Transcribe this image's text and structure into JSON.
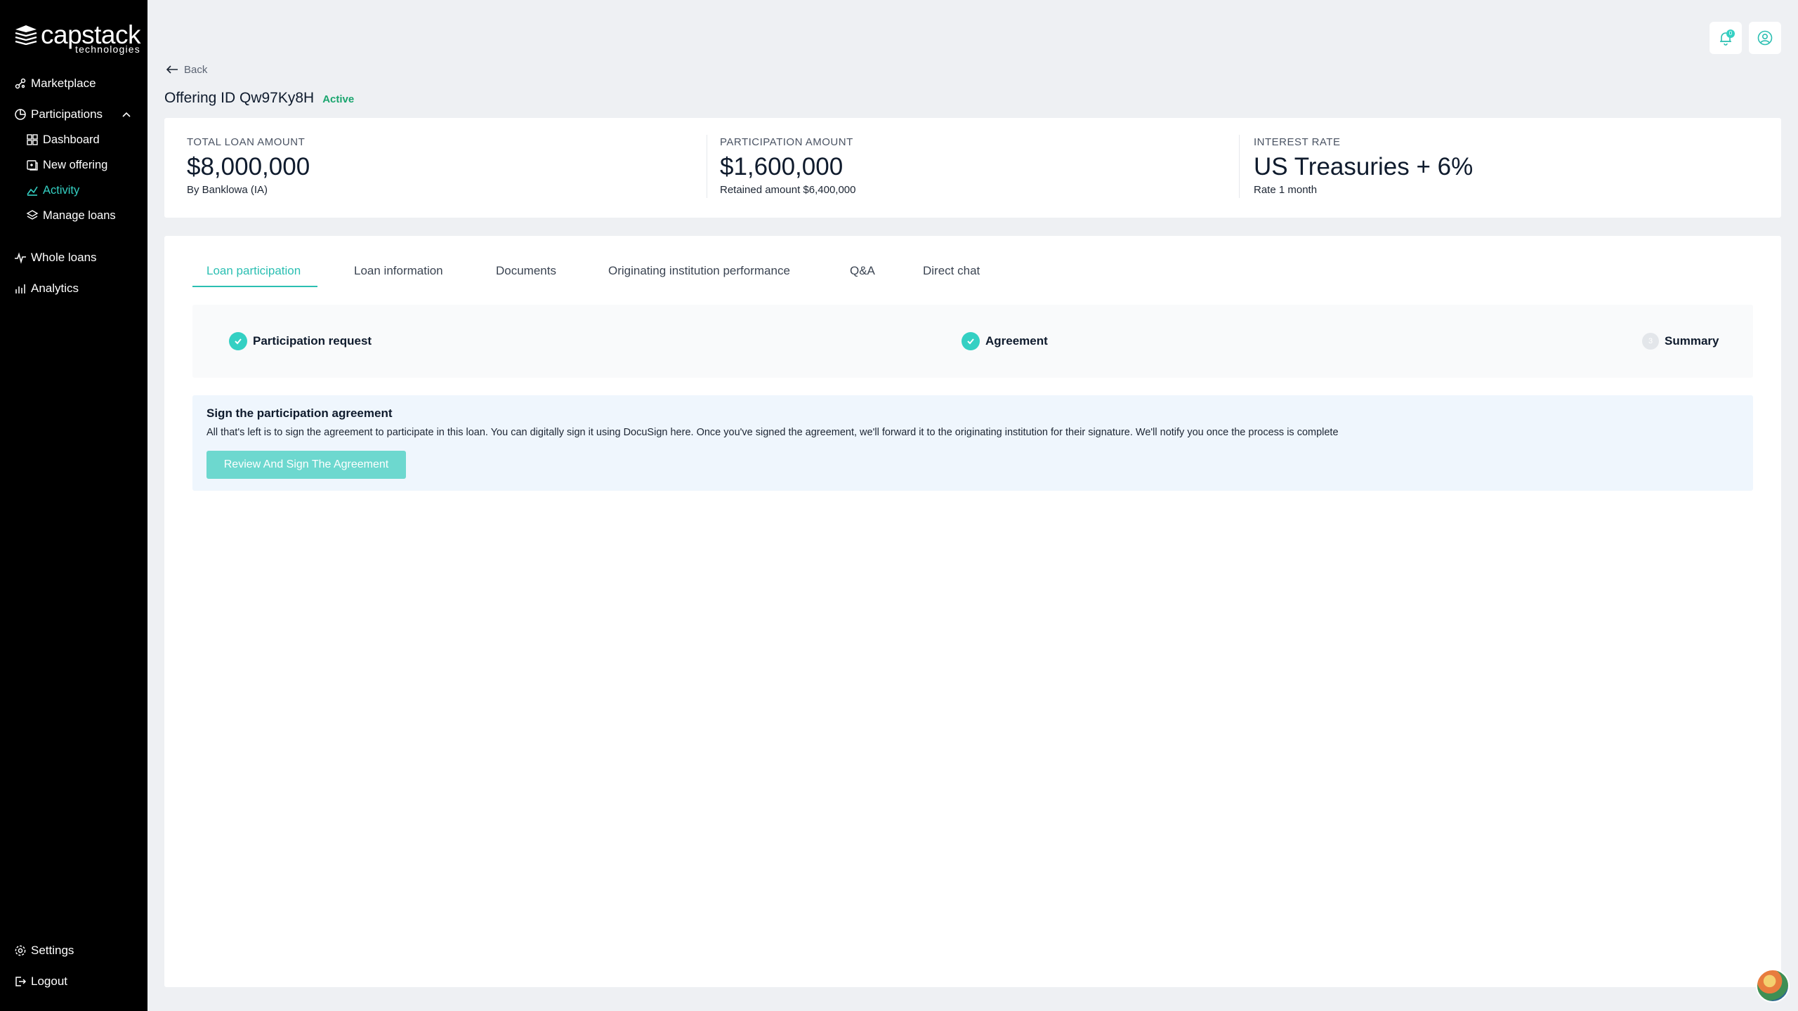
{
  "brand": {
    "name": "capstack",
    "sub": "technologies"
  },
  "sidebar": {
    "items": [
      {
        "label": "Marketplace",
        "icon": "marketplace-icon"
      },
      {
        "label": "Participations",
        "icon": "participations-icon"
      },
      {
        "label": "Dashboard",
        "icon": "dashboard-icon"
      },
      {
        "label": "New offering",
        "icon": "new-offering-icon"
      },
      {
        "label": "Activity",
        "icon": "activity-icon"
      },
      {
        "label": "Manage loans",
        "icon": "manage-loans-icon"
      },
      {
        "label": "Whole loans",
        "icon": "whole-loans-icon"
      },
      {
        "label": "Analytics",
        "icon": "analytics-icon"
      }
    ],
    "bottom": [
      {
        "label": "Settings",
        "icon": "gear-icon"
      },
      {
        "label": "Logout",
        "icon": "logout-icon"
      }
    ]
  },
  "topbar": {
    "notification_count": "0"
  },
  "header": {
    "back_label": "Back",
    "title": "Offering ID Qw97Ky8H",
    "status": "Active"
  },
  "stats": [
    {
      "label": "TOTAL LOAN AMOUNT",
      "value": "$8,000,000",
      "sub": "By Banklowa (IA)"
    },
    {
      "label": "PARTICIPATION AMOUNT",
      "value": "$1,600,000",
      "sub": "Retained amount $6,400,000"
    },
    {
      "label": "INTEREST RATE",
      "value": "US Treasuries + 6%",
      "sub": "Rate 1 month"
    }
  ],
  "tabs": [
    {
      "label": "Loan participation"
    },
    {
      "label": "Loan information"
    },
    {
      "label": "Documents"
    },
    {
      "label": "Originating institution performance"
    },
    {
      "label": "Q&A"
    },
    {
      "label": "Direct chat"
    }
  ],
  "steps": [
    {
      "label": "Participation request",
      "state": "done"
    },
    {
      "label": "Agreement",
      "state": "done"
    },
    {
      "label": "Summary",
      "state": "pending",
      "number": "3"
    }
  ],
  "agreement": {
    "title": "Sign the participation agreement",
    "text": "All that's left is to sign the agreement to participate in this loan. You can digitally sign it using DocuSign here. Once you've signed the agreement, we'll forward it to the originating institution for their signature. We'll notify you once the process is complete",
    "button_label": "Review And Sign The Agreement"
  },
  "colors": {
    "accent": "#34d0c3",
    "active_status": "#1aa56e",
    "sidebar_bg": "#000000"
  }
}
